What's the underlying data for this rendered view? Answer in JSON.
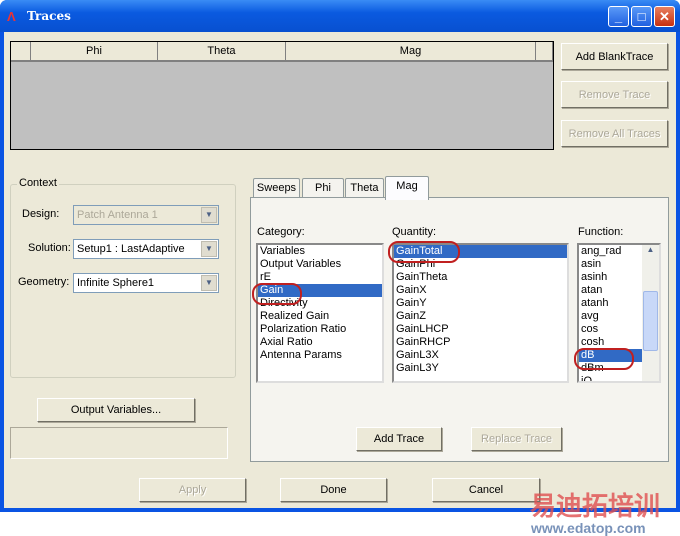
{
  "window": {
    "title": "Traces"
  },
  "grid": {
    "columns": [
      "",
      "Phi",
      "Theta",
      "Mag",
      ""
    ]
  },
  "side_buttons": {
    "add_blank": "Add BlankTrace",
    "remove": "Remove Trace",
    "remove_all": "Remove All Traces"
  },
  "context": {
    "legend": "Context",
    "design_label": "Design:",
    "design_value": "Patch Antenna 1",
    "solution_label": "Solution:",
    "solution_value": "Setup1 : LastAdaptive",
    "geometry_label": "Geometry:",
    "geometry_value": "Infinite Sphere1"
  },
  "output_variables": "Output Variables...",
  "tabs": [
    "Sweeps",
    "Phi",
    "Theta",
    "Mag"
  ],
  "category": {
    "label": "Category:",
    "items": [
      "Variables",
      "Output Variables",
      "rE",
      "Gain",
      "Directivity",
      "Realized Gain",
      "Polarization Ratio",
      "Axial Ratio",
      "Antenna Params"
    ],
    "selected": 3
  },
  "quantity": {
    "label": "Quantity:",
    "items": [
      "GainTotal",
      "GainPhi",
      "GainTheta",
      "GainX",
      "GainY",
      "GainZ",
      "GainLHCP",
      "GainRHCP",
      "GainL3X",
      "GainL3Y"
    ],
    "selected": 0
  },
  "function": {
    "label": "Function:",
    "items": [
      "ang_rad",
      "asin",
      "asinh",
      "atan",
      "atanh",
      "avg",
      "cos",
      "cosh",
      "dB",
      "dBm",
      "iO"
    ],
    "selected": 8
  },
  "panel_buttons": {
    "add": "Add Trace",
    "replace": "Replace Trace"
  },
  "bottom": {
    "apply": "Apply",
    "done": "Done",
    "cancel": "Cancel"
  },
  "watermark": {
    "cn": "易迪拓培训",
    "url": "www.edatop.com"
  }
}
